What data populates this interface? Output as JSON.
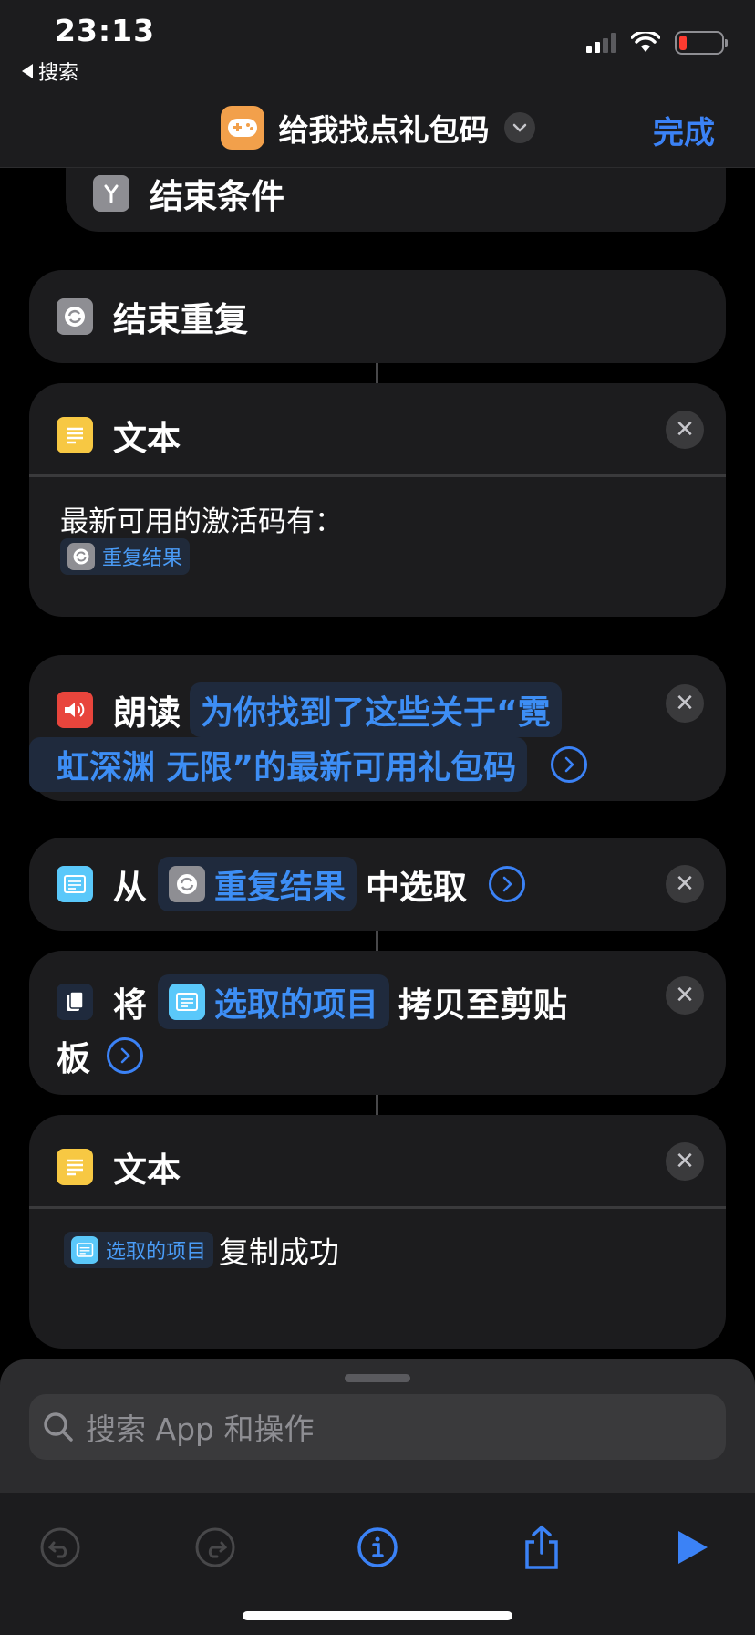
{
  "status": {
    "time": "23:13",
    "back_app": "搜索"
  },
  "nav": {
    "title": "给我找点礼包码",
    "done": "完成"
  },
  "actions": {
    "end_if": {
      "title": "结束条件"
    },
    "end_repeat": {
      "title": "结束重复"
    },
    "text1": {
      "title": "文本",
      "body": "最新可用的激活码有：",
      "var": "重复结果"
    },
    "speak": {
      "title": "朗读",
      "param_line1": "为你找到了这些关于“霓",
      "param_line2": "虹深渊 无限”的最新可用礼包码"
    },
    "choose": {
      "from": "从",
      "var": "重复结果",
      "suffix": "中选取"
    },
    "copy": {
      "verb": "将",
      "var": "选取的项目",
      "suffix1": "拷贝至剪贴",
      "suffix2": "板"
    },
    "text2": {
      "title": "文本",
      "var": "选取的项目",
      "body": "复制成功"
    }
  },
  "sheet": {
    "search_placeholder": "搜索 App 和操作"
  },
  "colors": {
    "accent": "#3b82f6",
    "card": "#1c1c1e",
    "text_icon": "#f7c843",
    "speak_icon": "#e8453c",
    "list_icon": "#5ac8fa"
  }
}
